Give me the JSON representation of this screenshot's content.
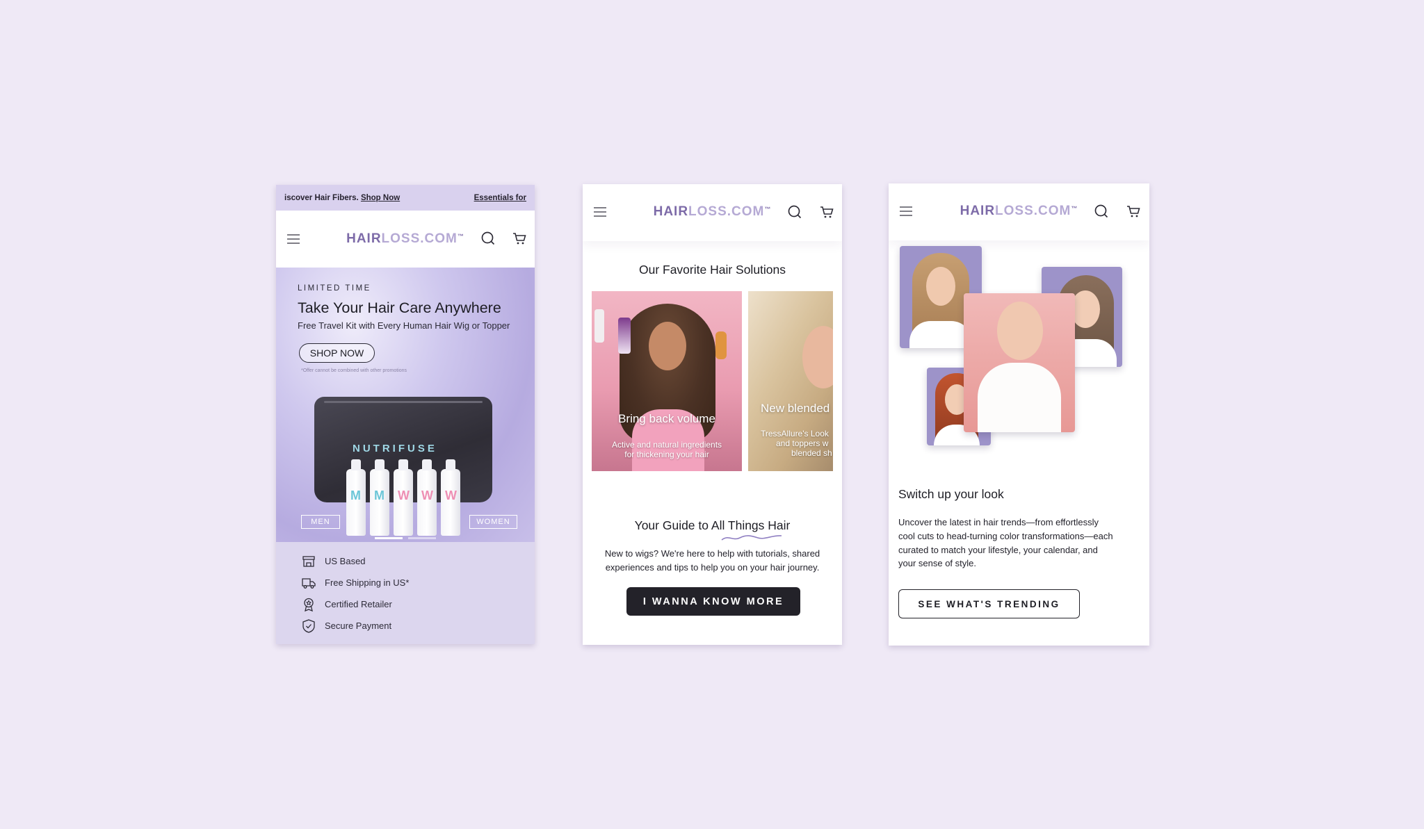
{
  "brand": {
    "logo_dark": "HAIR",
    "logo_light": "LOSS.COM",
    "logo_tm": "™"
  },
  "screen1": {
    "announcement": {
      "text": "iscover Hair Fibers.",
      "link": "Shop Now",
      "next": "Essentials for"
    },
    "hero": {
      "eyebrow": "LIMITED TIME",
      "title": "Take Your Hair Care Anywhere",
      "subtitle": "Free Travel Kit with Every Human Hair Wig or Topper",
      "cta": "SHOP NOW",
      "disclaimer": "*Offer cannot be combined with other promotions",
      "product_brand": "NUTRIFUSE",
      "tag_left": "MEN",
      "tag_right": "WOMEN"
    },
    "features": [
      {
        "label": "US Based",
        "icon": "store-icon"
      },
      {
        "label": "Free Shipping in US*",
        "icon": "truck-icon"
      },
      {
        "label": "Certified Retailer",
        "icon": "award-icon"
      },
      {
        "label": "Secure Payment",
        "icon": "shield-icon"
      }
    ]
  },
  "screen2": {
    "section_title": "Our Favorite Hair Solutions",
    "slides": [
      {
        "heading": "Bring back volume",
        "text_line1": "Active and natural ingredients",
        "text_line2": "for thickening your hair"
      },
      {
        "heading": "New blended",
        "text_line1": "TressAllure's Look",
        "text_line2": "and toppers w",
        "text_line3": "blended sh"
      }
    ],
    "guide": {
      "title": "Your Guide to All Things Hair",
      "text_line1": "New to wigs? We're here to help with tutorials, shared",
      "text_line2": "experiences and tips to help you on your hair journey.",
      "cta": "I WANNA KNOW MORE"
    }
  },
  "screen3": {
    "title": "Switch up your look",
    "text_line1": "Uncover the latest in hair trends—from effortlessly",
    "text_line2": "cool cuts to head-turning color transformations—each",
    "text_line3": "curated to match your lifestyle, your calendar, and",
    "text_line4": "your sense of style.",
    "cta": "SEE WHAT'S TRENDING"
  },
  "colors": {
    "background": "#efe9f6",
    "brand_purple": "#7d6ba8",
    "brand_light": "#b5a9d4",
    "dark_button": "#232229"
  }
}
